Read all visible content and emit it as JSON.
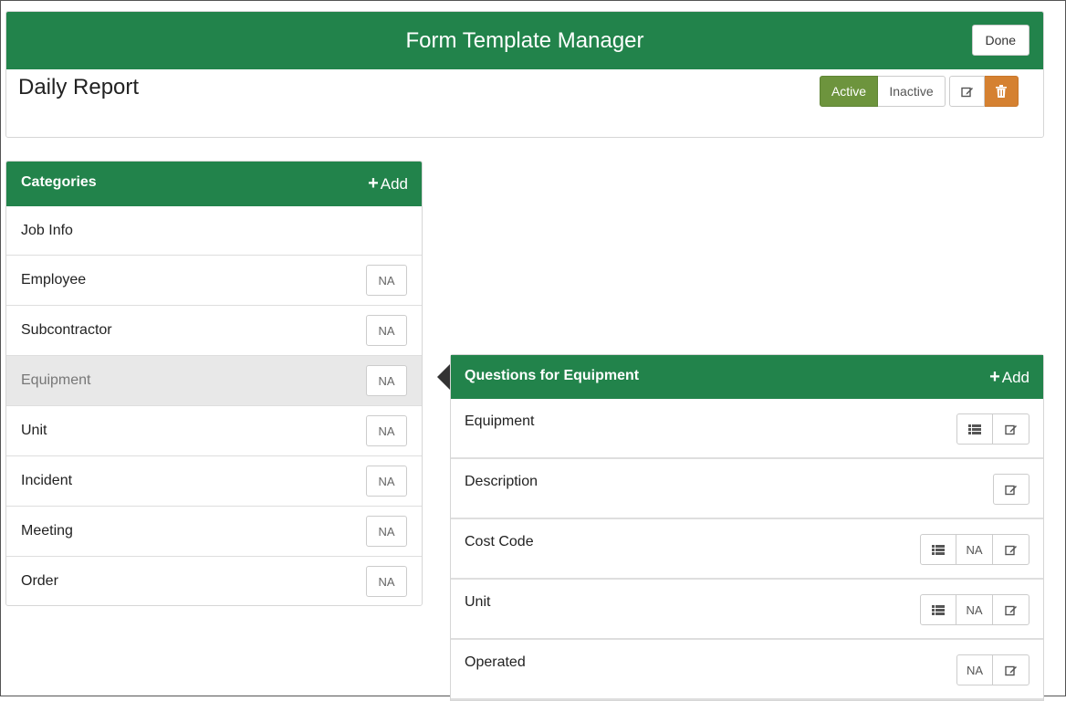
{
  "header": {
    "title": "Form Template Manager",
    "done_label": "Done"
  },
  "form": {
    "name": "Daily Report",
    "status_active_label": "Active",
    "status_inactive_label": "Inactive",
    "selected_status": "Active",
    "edit_icon": "edit-icon",
    "delete_icon": "trash-icon"
  },
  "categories": {
    "title": "Categories",
    "add_label": "Add",
    "items": [
      {
        "label": "Job Info",
        "na": ""
      },
      {
        "label": "Employee",
        "na": "NA"
      },
      {
        "label": "Subcontractor",
        "na": "NA"
      },
      {
        "label": "Equipment",
        "na": "NA"
      },
      {
        "label": "Unit",
        "na": "NA"
      },
      {
        "label": "Incident",
        "na": "NA"
      },
      {
        "label": "Meeting",
        "na": "NA"
      },
      {
        "label": "Order",
        "na": "NA"
      }
    ],
    "selected": "Equipment"
  },
  "questions": {
    "title": "Questions for Equipment",
    "add_label": "Add",
    "items": [
      {
        "label": "Equipment",
        "na": ""
      },
      {
        "label": "Description",
        "na": ""
      },
      {
        "label": "Cost Code",
        "na": "NA"
      },
      {
        "label": "Unit",
        "na": "NA"
      },
      {
        "label": "Operated",
        "na": "NA"
      }
    ]
  },
  "colors": {
    "primary_green": "#22834b",
    "active_green": "#6d943d",
    "danger_orange": "#d58131"
  }
}
